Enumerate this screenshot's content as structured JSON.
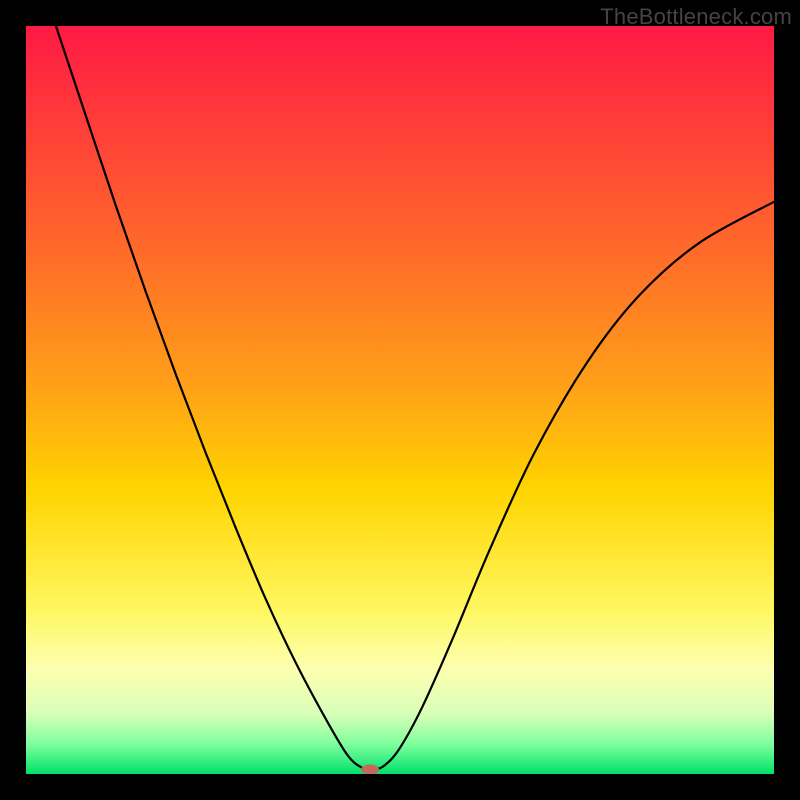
{
  "watermark": "TheBottleneck.com",
  "chart_data": {
    "type": "line",
    "title": "",
    "xlabel": "",
    "ylabel": "",
    "xlim": [
      0,
      100
    ],
    "ylim": [
      0,
      100
    ],
    "background_gradient": {
      "stops": [
        {
          "offset": 0.0,
          "color": "#ff1a44"
        },
        {
          "offset": 0.12,
          "color": "#ff3a3a"
        },
        {
          "offset": 0.3,
          "color": "#ff6a2a"
        },
        {
          "offset": 0.48,
          "color": "#ffa018"
        },
        {
          "offset": 0.62,
          "color": "#ffd400"
        },
        {
          "offset": 0.78,
          "color": "#fff760"
        },
        {
          "offset": 0.86,
          "color": "#fdffb0"
        },
        {
          "offset": 0.92,
          "color": "#d8ffb8"
        },
        {
          "offset": 0.96,
          "color": "#7fff9e"
        },
        {
          "offset": 1.0,
          "color": "#00e06a"
        }
      ]
    },
    "series": [
      {
        "name": "bottleneck-curve",
        "color": "#000000",
        "stroke_width": 2.2,
        "points": [
          {
            "x": 4.0,
            "y": 100.0
          },
          {
            "x": 8.0,
            "y": 88.0
          },
          {
            "x": 12.0,
            "y": 76.0
          },
          {
            "x": 16.0,
            "y": 64.5
          },
          {
            "x": 20.0,
            "y": 53.5
          },
          {
            "x": 24.0,
            "y": 43.0
          },
          {
            "x": 28.0,
            "y": 33.0
          },
          {
            "x": 32.0,
            "y": 23.5
          },
          {
            "x": 36.0,
            "y": 15.0
          },
          {
            "x": 40.0,
            "y": 7.5
          },
          {
            "x": 43.0,
            "y": 2.5
          },
          {
            "x": 45.0,
            "y": 0.8
          },
          {
            "x": 46.5,
            "y": 0.6
          },
          {
            "x": 48.0,
            "y": 1.2
          },
          {
            "x": 50.0,
            "y": 3.5
          },
          {
            "x": 53.0,
            "y": 9.0
          },
          {
            "x": 57.0,
            "y": 18.0
          },
          {
            "x": 62.0,
            "y": 30.0
          },
          {
            "x": 68.0,
            "y": 43.0
          },
          {
            "x": 75.0,
            "y": 55.0
          },
          {
            "x": 82.0,
            "y": 64.0
          },
          {
            "x": 90.0,
            "y": 71.0
          },
          {
            "x": 100.0,
            "y": 76.5
          }
        ]
      }
    ],
    "marker": {
      "name": "optimal-point",
      "x": 46.0,
      "y": 0.6,
      "color": "#c46a5a",
      "rx": 9,
      "ry": 5
    }
  }
}
